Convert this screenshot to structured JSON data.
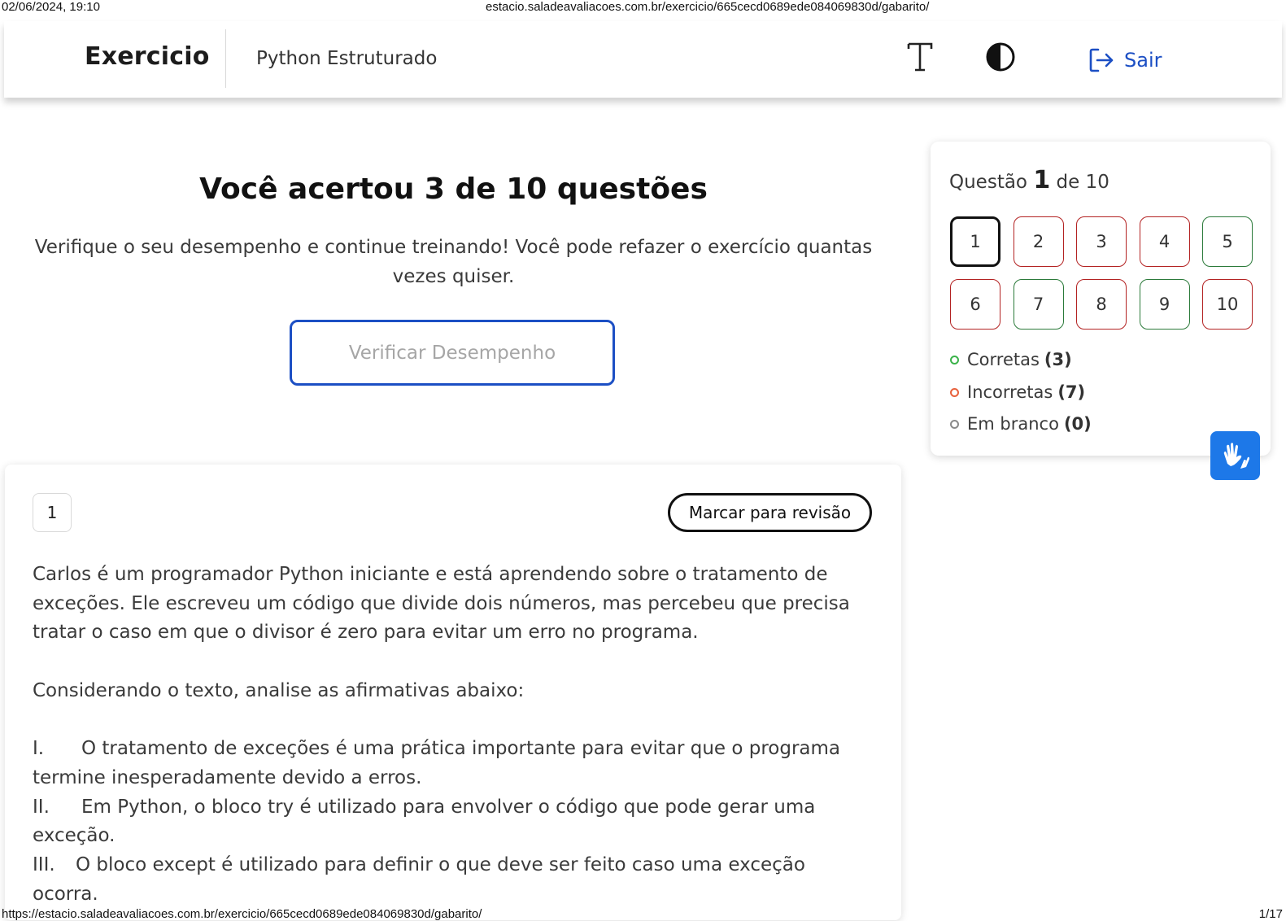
{
  "print_header": {
    "datetime": "02/06/2024, 19:10",
    "url": "estacio.saladeavaliacoes.com.br/exercicio/665cecd0689ede084069830d/gabarito/"
  },
  "print_footer": {
    "url": "https://estacio.saladeavaliacoes.com.br/exercicio/665cecd0689ede084069830d/gabarito/",
    "page": "1/17"
  },
  "topbar": {
    "brand": "Exercicio",
    "course": "Python Estruturado",
    "font_icon": "font-size-icon",
    "contrast_icon": "contrast-icon",
    "logout_icon": "logout-icon",
    "logout_label": "Sair",
    "accent_color": "#1c4fc4"
  },
  "result": {
    "title": "Você acertou 3 de 10 questões",
    "subtitle": "Verifique o seu desempenho e continue treinando! Você pode refazer o exercício quantas vezes quiser.",
    "verify_button": "Verificar Desempenho"
  },
  "navigator": {
    "prefix": "Questão",
    "current": "1",
    "suffix": "de 10",
    "questions": [
      {
        "label": "1",
        "status": "correct",
        "current": true
      },
      {
        "label": "2",
        "status": "wrong",
        "current": false
      },
      {
        "label": "3",
        "status": "wrong",
        "current": false
      },
      {
        "label": "4",
        "status": "wrong",
        "current": false
      },
      {
        "label": "5",
        "status": "correct",
        "current": false
      },
      {
        "label": "6",
        "status": "wrong",
        "current": false
      },
      {
        "label": "7",
        "status": "correct",
        "current": false
      },
      {
        "label": "8",
        "status": "wrong",
        "current": false
      },
      {
        "label": "9",
        "status": "correct",
        "current": false
      },
      {
        "label": "10",
        "status": "wrong",
        "current": false
      }
    ],
    "legend": [
      {
        "label": "Corretas",
        "count": "(3)",
        "color": "#3bb34a"
      },
      {
        "label": "Incorretas",
        "count": "(7)",
        "color": "#e8613c"
      },
      {
        "label": "Em branco",
        "count": "(0)",
        "color": "#8a8a8a"
      }
    ],
    "status_colors": {
      "correct": "#2b7a3a",
      "wrong": "#b32222"
    }
  },
  "accessibility": {
    "libras_icon": "sign-language-hands-icon",
    "color": "#1d78e8"
  },
  "question": {
    "number": "1",
    "review_button": "Marcar para revisão",
    "paragraph1": "Carlos é um programador Python iniciante e está aprendendo sobre o tratamento de exceções. Ele escreveu um código que divide dois números, mas percebeu que precisa tratar o caso em que o divisor é zero para evitar um erro no programa.",
    "paragraph2": "Considerando o texto, analise as afirmativas abaixo:",
    "statements": [
      {
        "numeral": "I.",
        "text": "O tratamento de exceções é uma prática importante para evitar que o programa termine inesperadamente devido a erros."
      },
      {
        "numeral": "II.",
        "text": "Em Python, o bloco try é utilizado para envolver o código que pode gerar uma exceção."
      },
      {
        "numeral": "III.",
        "text": "O bloco except é utilizado para definir o que deve ser feito caso uma exceção ocorra."
      }
    ]
  }
}
